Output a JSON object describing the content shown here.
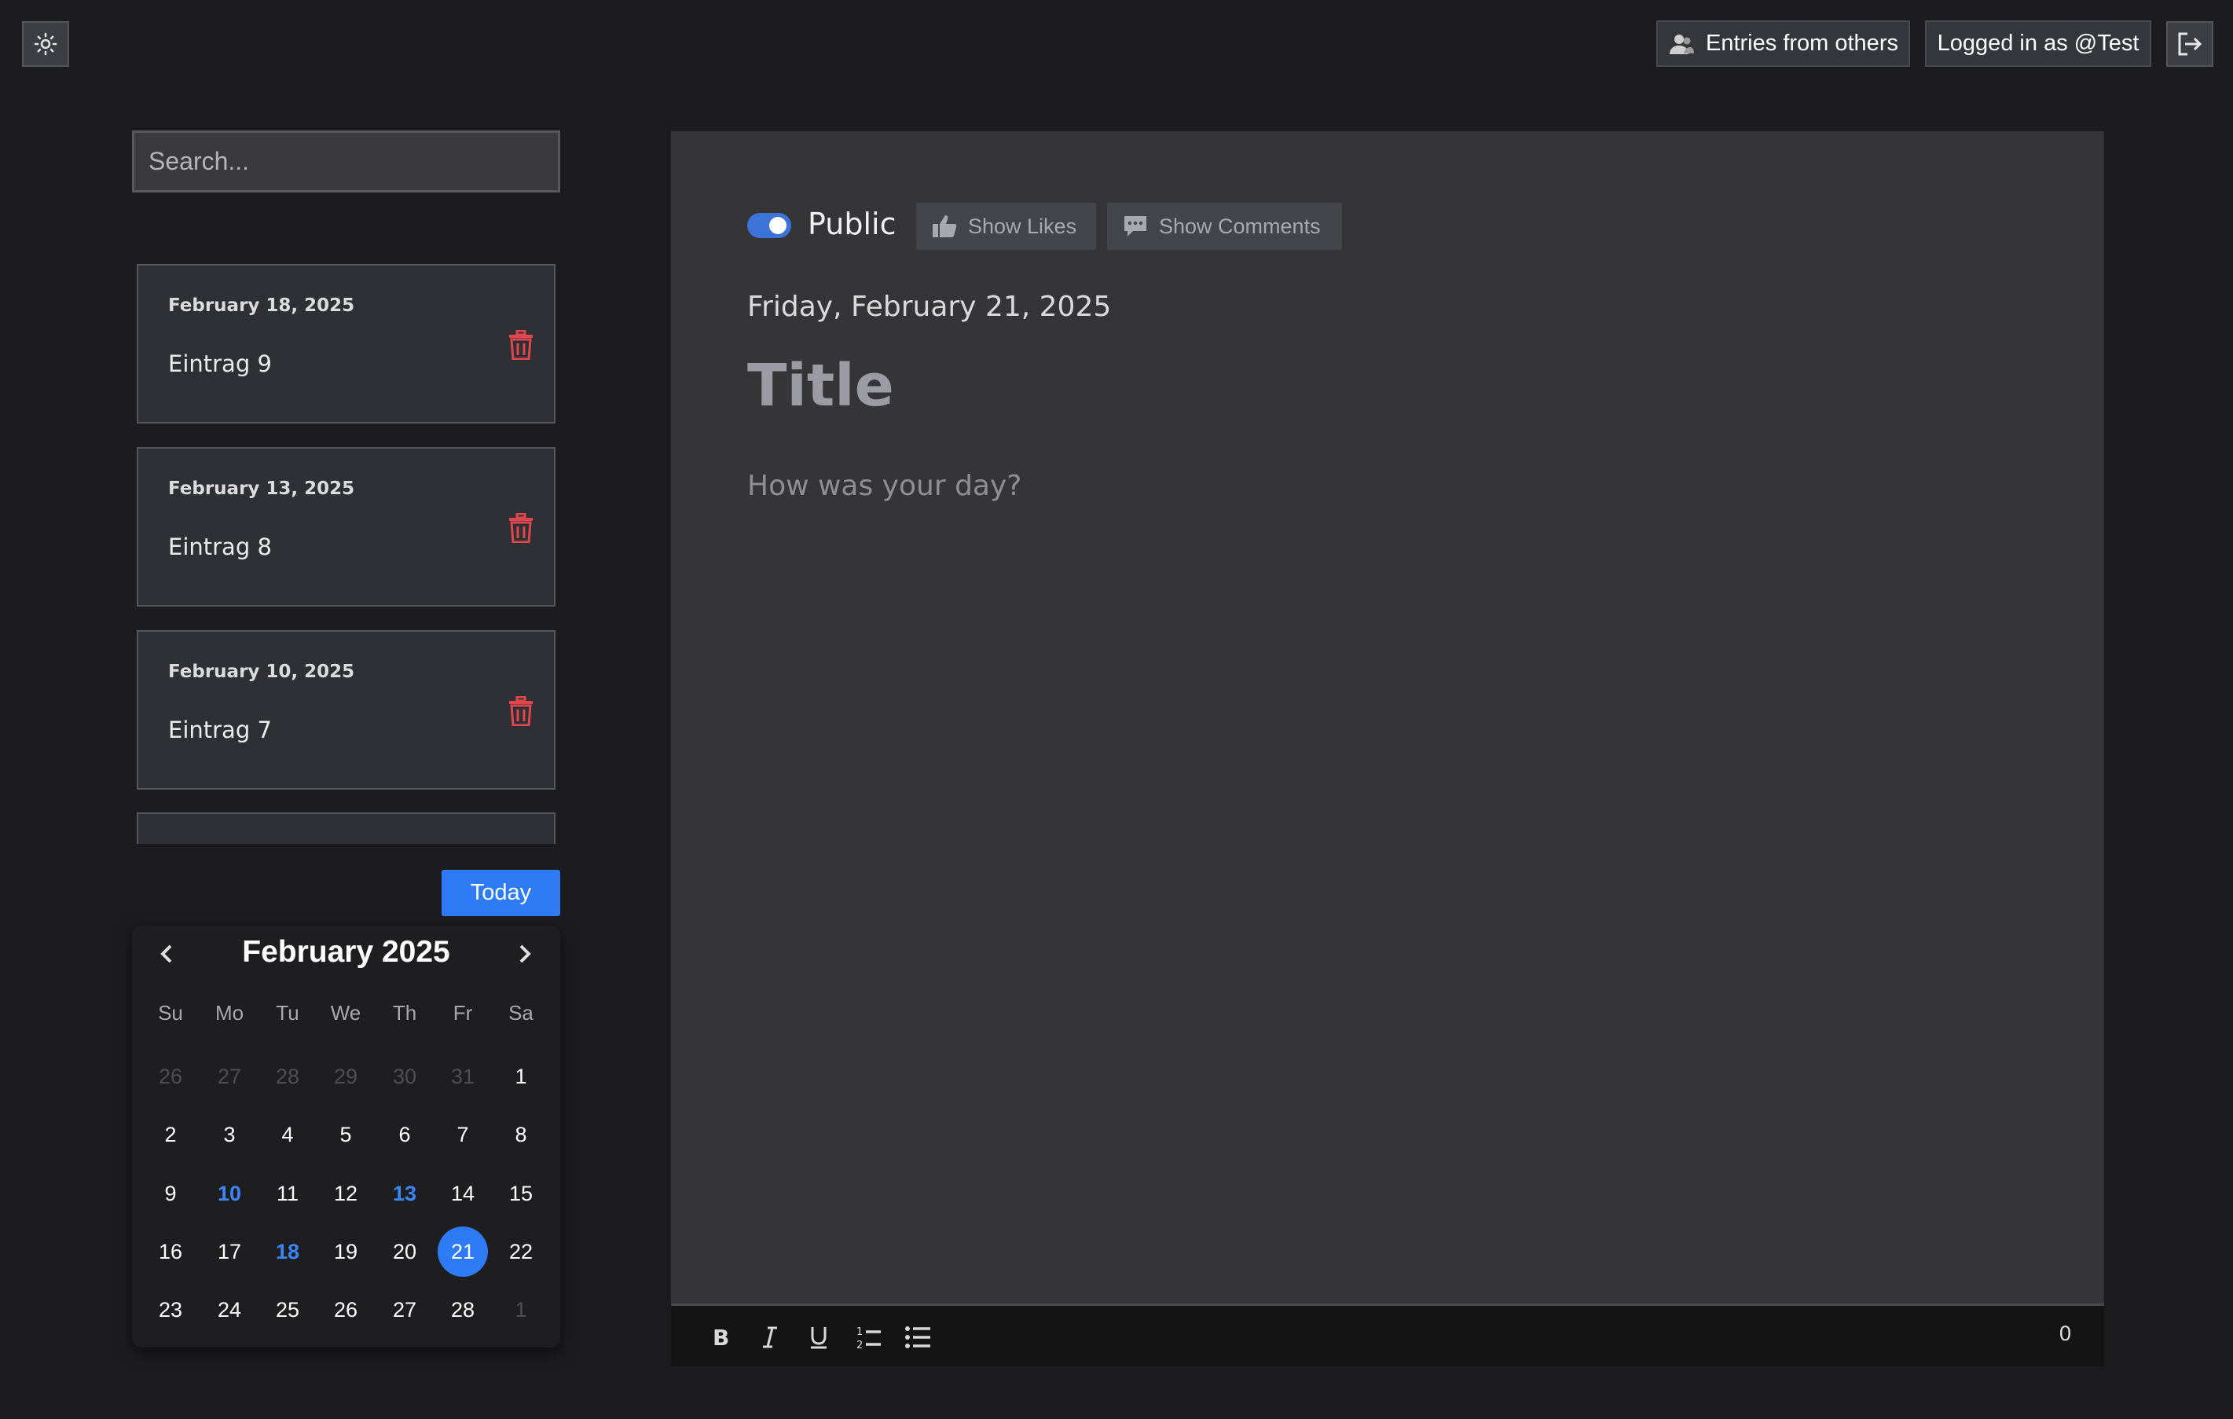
{
  "header": {
    "theme_icon": "sun-icon",
    "entries_from_others": "Entries from others",
    "logged_in": "Logged in as @Test",
    "logout_icon": "logout-icon"
  },
  "search": {
    "placeholder": "Search..."
  },
  "entries": [
    {
      "date": "February 18, 2025",
      "title": "Eintrag 9"
    },
    {
      "date": "February 13, 2025",
      "title": "Eintrag 8"
    },
    {
      "date": "February 10, 2025",
      "title": "Eintrag 7"
    }
  ],
  "calendar": {
    "today_label": "Today",
    "month_label": "February 2025",
    "weekdays": [
      "Su",
      "Mo",
      "Tu",
      "We",
      "Th",
      "Fr",
      "Sa"
    ],
    "weeks": [
      [
        "26",
        "27",
        "28",
        "29",
        "30",
        "31",
        "1"
      ],
      [
        "2",
        "3",
        "4",
        "5",
        "6",
        "7",
        "8"
      ],
      [
        "9",
        "10",
        "11",
        "12",
        "13",
        "14",
        "15"
      ],
      [
        "16",
        "17",
        "18",
        "19",
        "20",
        "21",
        "22"
      ],
      [
        "23",
        "24",
        "25",
        "26",
        "27",
        "28",
        "1"
      ]
    ],
    "muted_days": [
      "26",
      "27",
      "28",
      "29",
      "30",
      "31"
    ],
    "marked_days": [
      "10",
      "13",
      "18"
    ],
    "selected_day": "21",
    "colors": {
      "accent": "#2f7bf5",
      "marked": "#3a86ff",
      "danger": "#e0474c"
    }
  },
  "editor": {
    "public_label": "Public",
    "public_on": true,
    "show_likes": "Show Likes",
    "show_comments": "Show Comments",
    "date_heading": "Friday, February 21, 2025",
    "title_placeholder": "Title",
    "body_placeholder": "How was your day?",
    "word_count": "0"
  }
}
